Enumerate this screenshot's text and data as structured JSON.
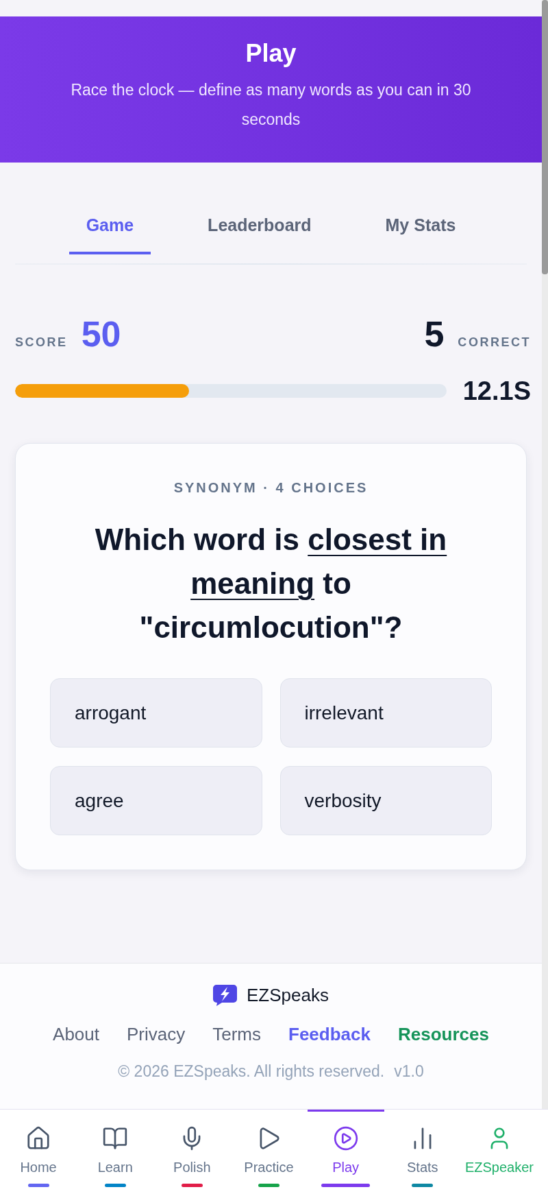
{
  "header": {
    "title": "Play",
    "subtitle": "Race the clock — define as many words as you can in 30 seconds"
  },
  "tabs": [
    {
      "label": "Game",
      "selected": true
    },
    {
      "label": "Leaderboard",
      "selected": false
    },
    {
      "label": "My Stats",
      "selected": false
    }
  ],
  "score": {
    "label": "SCORE",
    "value": "50"
  },
  "correct": {
    "value": "5",
    "label": "CORRECT"
  },
  "timer": {
    "level": 0.404,
    "reading": "12.1S"
  },
  "question": {
    "category": "SYNONYM · 4 CHOICES",
    "prompt_start": "Which word is ",
    "prompt_emphasis": "closest in meaning",
    "prompt_end": " to \"circumlocution\"?",
    "choices": [
      "arrogant",
      "irrelevant",
      "agree",
      "verbosity"
    ]
  },
  "footer": {
    "brand": "EZSpeaks",
    "links": [
      {
        "label": "About",
        "kind": "plain"
      },
      {
        "label": "Privacy",
        "kind": "plain"
      },
      {
        "label": "Terms",
        "kind": "plain"
      },
      {
        "label": "Feedback",
        "kind": "highlight"
      },
      {
        "label": "Resources",
        "kind": "featured"
      }
    ],
    "copyright": "© 2026 EZSpeaks. All rights reserved.",
    "version": "v1.0"
  },
  "nav": {
    "items": [
      {
        "label": "Home",
        "kind": "section",
        "selected": false,
        "color": "#6366f1"
      },
      {
        "label": "Learn",
        "kind": "section",
        "selected": false,
        "color": "#0284c7"
      },
      {
        "label": "Polish",
        "kind": "section",
        "selected": false,
        "color": "#e11d48"
      },
      {
        "label": "Practice",
        "kind": "section",
        "selected": false,
        "color": "#16a34a"
      },
      {
        "label": "Play",
        "kind": "section",
        "selected": true,
        "color": "#7c3aed"
      },
      {
        "label": "Stats",
        "kind": "section",
        "selected": false,
        "color": "#0e88a3"
      },
      {
        "label": "EZSpeaker",
        "kind": "account",
        "selected": false,
        "color": "#1fb06a"
      }
    ]
  }
}
